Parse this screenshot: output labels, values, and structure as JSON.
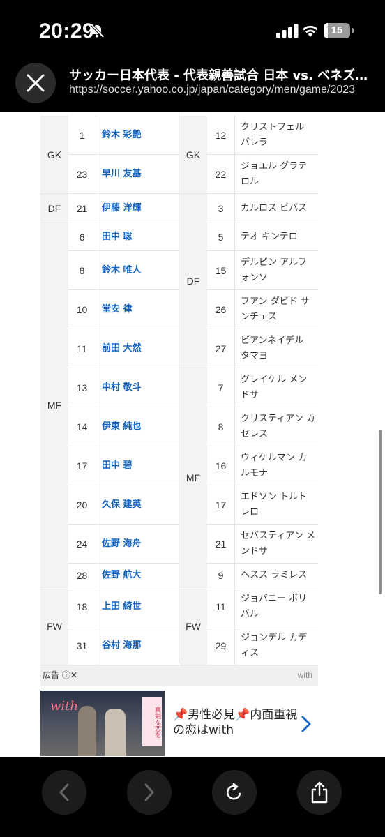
{
  "status_bar": {
    "time": "20:29",
    "battery_level": "15",
    "battery_fraction": 0.15
  },
  "browser": {
    "title": "サッカー日本代表 - 代表親善試合 日本 vs. ベネズエラ",
    "url": "https://soccer.yahoo.co.jp/japan/category/men/game/2023"
  },
  "lineup": {
    "home": {
      "groups": [
        {
          "position": "GK",
          "players": [
            {
              "number": "1",
              "name": "鈴木 彩艶"
            },
            {
              "number": "23",
              "name": "早川 友基"
            }
          ]
        },
        {
          "position": "DF",
          "players": [
            {
              "number": "21",
              "name": "伊藤 洋輝"
            }
          ]
        },
        {
          "position": "MF",
          "players": [
            {
              "number": "6",
              "name": "田中 聡"
            },
            {
              "number": "8",
              "name": "鈴木 唯人"
            },
            {
              "number": "10",
              "name": "堂安 律"
            },
            {
              "number": "11",
              "name": "前田 大然"
            },
            {
              "number": "13",
              "name": "中村 敬斗"
            },
            {
              "number": "14",
              "name": "伊東 純也"
            },
            {
              "number": "17",
              "name": "田中 碧"
            },
            {
              "number": "20",
              "name": "久保 建英"
            },
            {
              "number": "24",
              "name": "佐野 海舟"
            },
            {
              "number": "28",
              "name": "佐野 航大"
            }
          ]
        },
        {
          "position": "FW",
          "players": [
            {
              "number": "18",
              "name": "上田 綺世"
            },
            {
              "number": "31",
              "name": "谷村 海那"
            }
          ]
        }
      ]
    },
    "away": {
      "groups": [
        {
          "position": "GK",
          "players": [
            {
              "number": "12",
              "name": "クリストフェル バレラ"
            },
            {
              "number": "22",
              "name": "ジョエル グラテロル"
            }
          ]
        },
        {
          "position": "DF",
          "players": [
            {
              "number": "3",
              "name": "カルロス ビバス"
            },
            {
              "number": "5",
              "name": "テオ キンテロ"
            },
            {
              "number": "15",
              "name": "デルビン アルフォンソ"
            },
            {
              "number": "26",
              "name": "フアン ダビド サンチェス"
            },
            {
              "number": "27",
              "name": "ビアンネイデル タマヨ"
            }
          ]
        },
        {
          "position": "MF",
          "players": [
            {
              "number": "7",
              "name": "グレイケル メンドサ"
            },
            {
              "number": "8",
              "name": "クリスティアン カセレス"
            },
            {
              "number": "16",
              "name": "ウィケルマン カルモナ"
            },
            {
              "number": "17",
              "name": "エドソン トルトレロ"
            },
            {
              "number": "21",
              "name": "セバスティアン メンドサ"
            },
            {
              "number": "9",
              "name": "ヘスス ラミレス"
            }
          ]
        },
        {
          "position": "FW",
          "players": [
            {
              "number": "11",
              "name": "ジョバニー ボリバル"
            },
            {
              "number": "29",
              "name": "ジョンデル カディス"
            }
          ]
        }
      ]
    }
  },
  "ad": {
    "label": "広告",
    "brand": "with",
    "image_logo": "with",
    "image_ribbon": "真剣な恋を",
    "text": "📌男性必見📌内面重視の恋はwith"
  },
  "icons": {
    "close": "close-icon",
    "back": "chevron-left-icon",
    "forward": "chevron-right-icon",
    "reload": "reload-icon",
    "share": "share-icon"
  },
  "colors": {
    "link": "#1565c0",
    "position_bg": "#f3f3f3",
    "border": "#e4e4e4"
  }
}
